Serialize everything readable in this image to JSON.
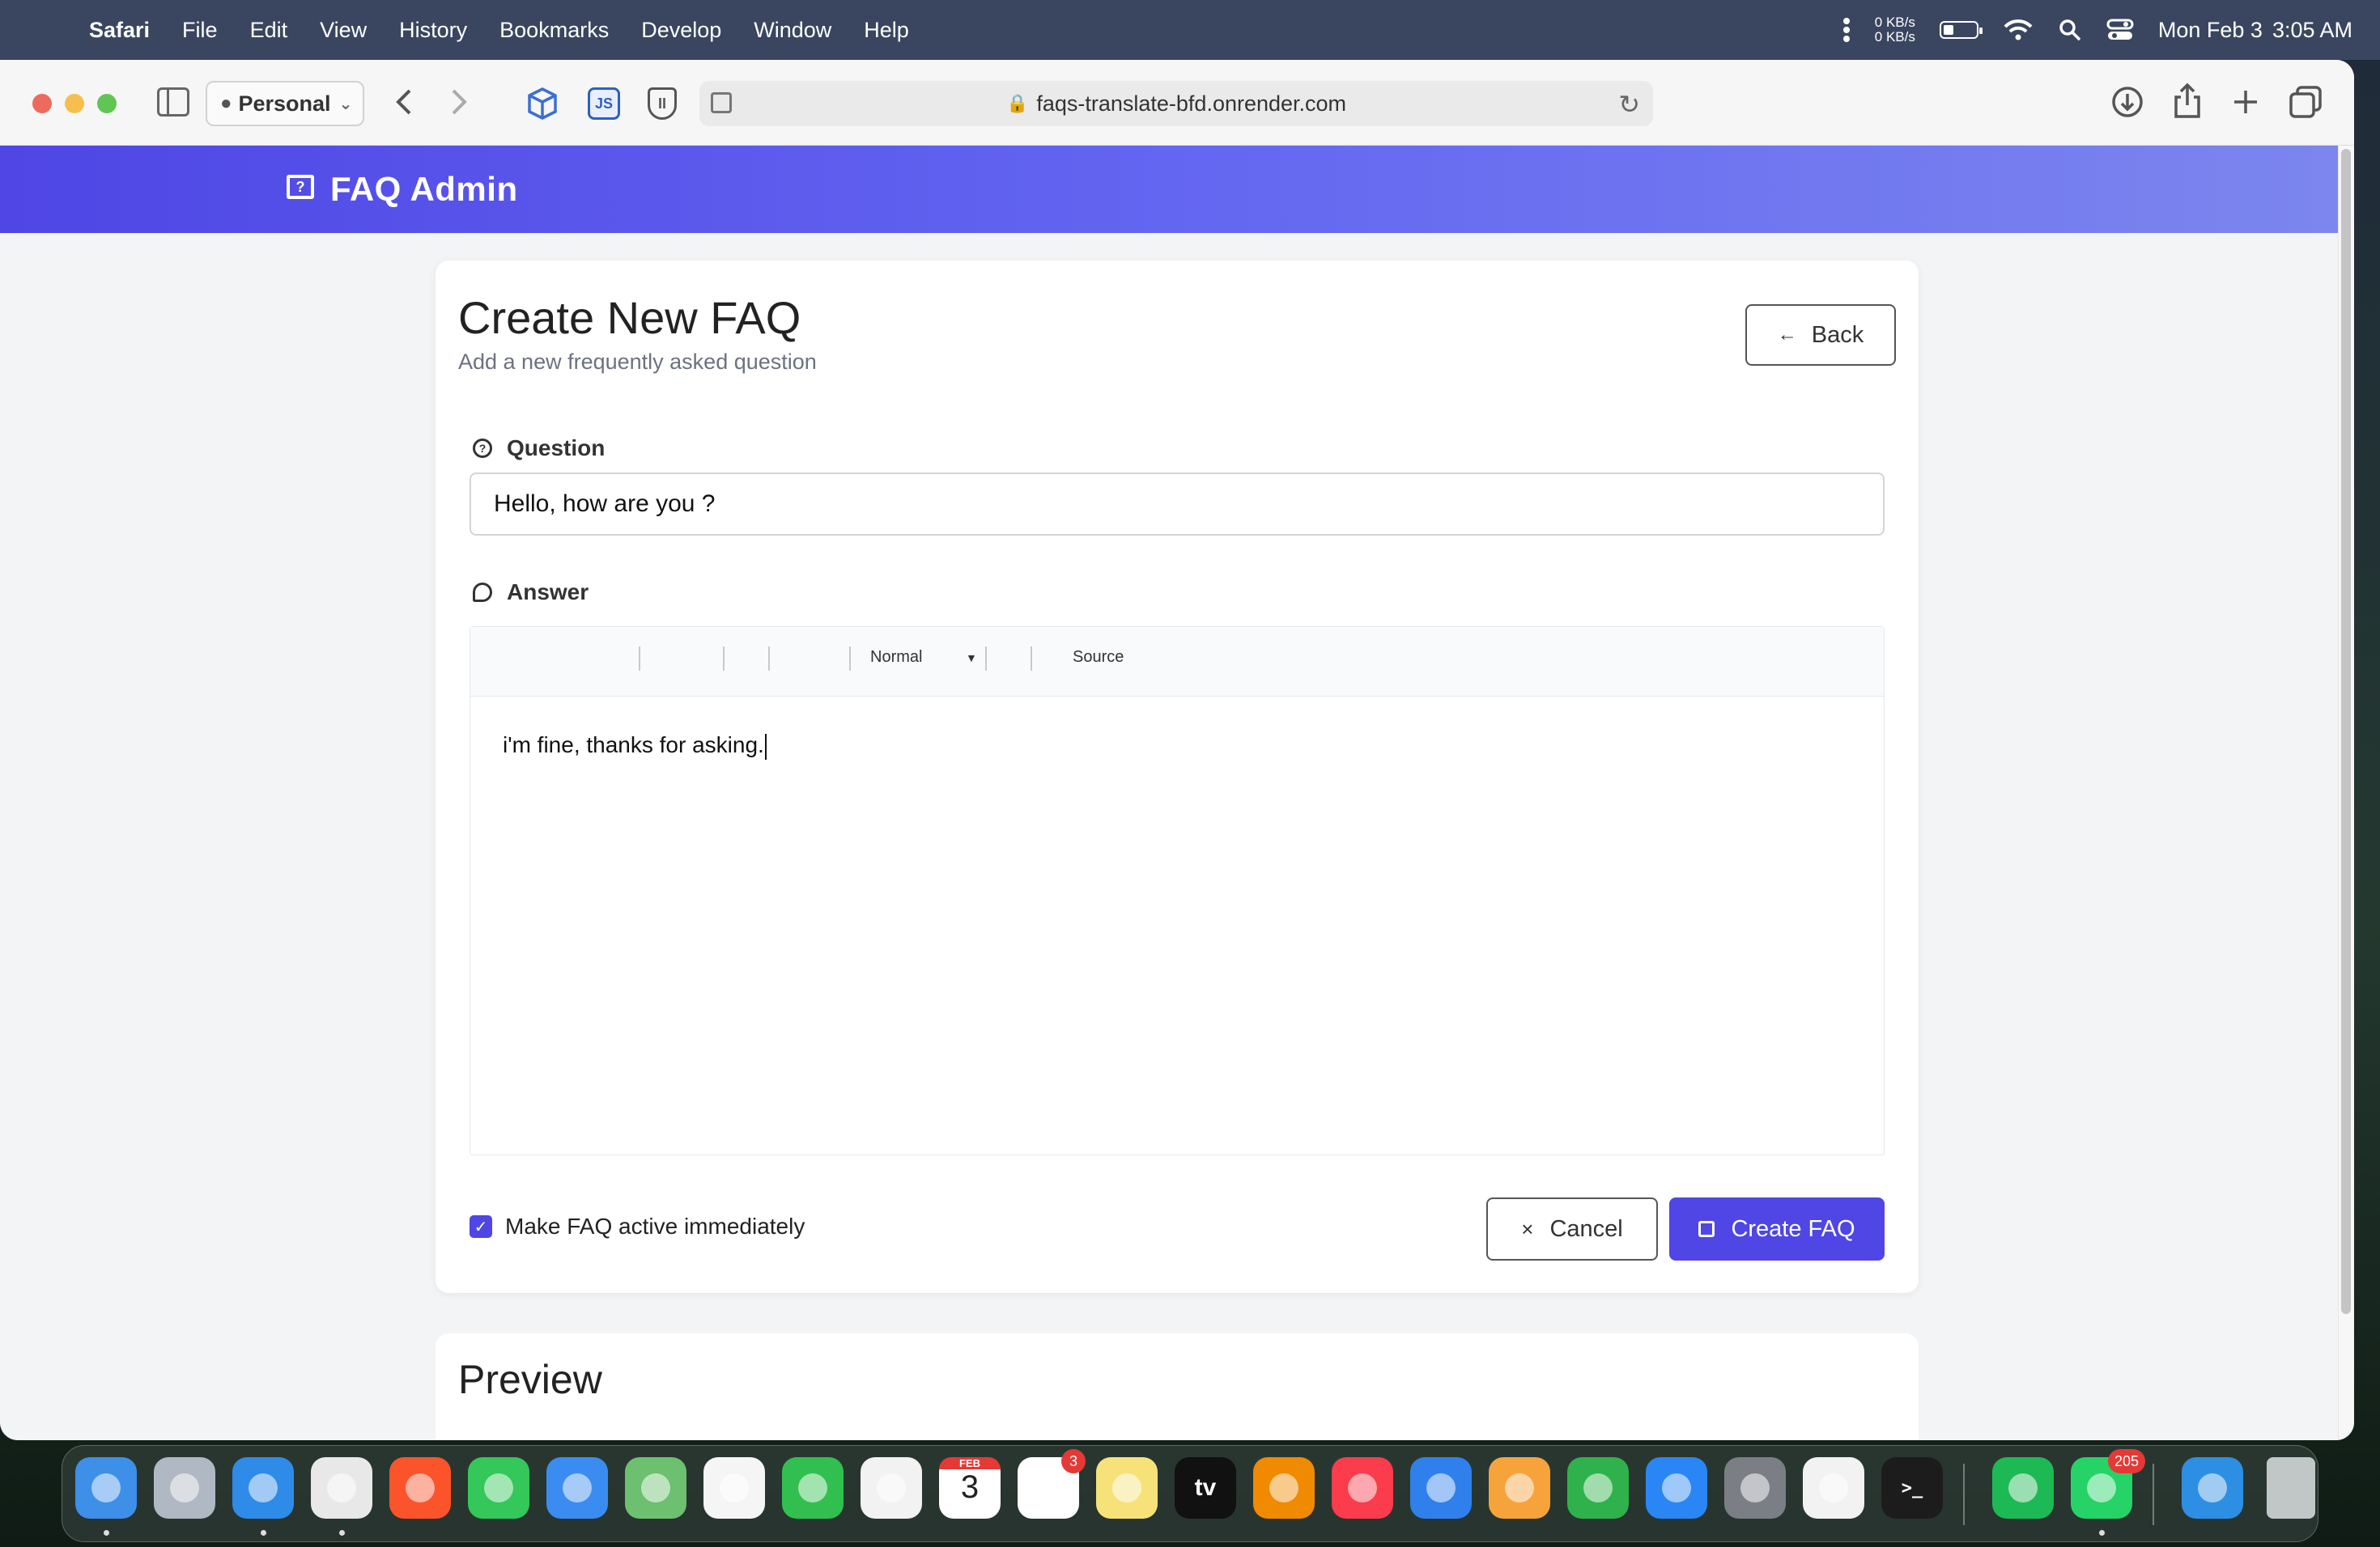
{
  "menubar": {
    "app_name": "Safari",
    "items": [
      "File",
      "Edit",
      "View",
      "History",
      "Bookmarks",
      "Develop",
      "Window",
      "Help"
    ],
    "net_up": "0 KB/s",
    "net_down": "0 KB/s",
    "date": "Mon Feb 3",
    "time": "3:05 AM"
  },
  "browser": {
    "profile": "Personal",
    "url": "faqs-translate-bfd.onrender.com",
    "ext_js_label": "JS",
    "ext_shield_label": "II"
  },
  "navbar": {
    "brand": "FAQ Admin"
  },
  "form": {
    "title": "Create New FAQ",
    "subtitle": "Add a new frequently asked question",
    "back_label": "Back",
    "question_label": "Question",
    "question_value": "Hello, how are you ?",
    "answer_label": "Answer",
    "editor_format": "Normal",
    "editor_source": "Source",
    "answer_value": "i'm fine, thanks for asking.",
    "active_label": "Make FAQ active immediately",
    "active_checked": true,
    "cancel_label": "Cancel",
    "create_label": "Create FAQ"
  },
  "preview": {
    "title": "Preview"
  },
  "dock": {
    "apps": [
      {
        "name": "Finder",
        "icon": "finder-icon",
        "color": "#3d8fe8"
      },
      {
        "name": "Launchpad",
        "icon": "launchpad-icon",
        "color": "#b0b8c4"
      },
      {
        "name": "Safari",
        "icon": "safari-icon",
        "color": "#2f8be8"
      },
      {
        "name": "Chrome",
        "icon": "chrome-icon",
        "color": "#e8e8e8"
      },
      {
        "name": "Brave",
        "icon": "brave-icon",
        "color": "#fb542b"
      },
      {
        "name": "Messages",
        "icon": "messages-icon",
        "color": "#34c759"
      },
      {
        "name": "Mail",
        "icon": "mail-icon",
        "color": "#3a8cf0"
      },
      {
        "name": "Maps",
        "icon": "maps-icon",
        "color": "#6cc070"
      },
      {
        "name": "Photos",
        "icon": "photos-icon",
        "color": "#f5f5f5"
      },
      {
        "name": "FaceTime",
        "icon": "facetime-icon",
        "color": "#31c04f"
      },
      {
        "name": "Spark Mail",
        "icon": "envelope-icon",
        "color": "#f2f2f2"
      },
      {
        "name": "Calendar",
        "icon": "calendar-icon",
        "color": "#ffffff"
      },
      {
        "name": "Reminders",
        "icon": "reminders-icon",
        "color": "#ffffff"
      },
      {
        "name": "Notes",
        "icon": "notes-icon",
        "color": "#f7e27a"
      },
      {
        "name": "Apple TV",
        "icon": "appletv-icon",
        "color": "#111111"
      },
      {
        "name": "VLC",
        "icon": "vlc-icon",
        "color": "#f08a00"
      },
      {
        "name": "Music",
        "icon": "music-icon",
        "color": "#fa3c4c"
      },
      {
        "name": "Keynote",
        "icon": "keynote-icon",
        "color": "#2f80ed"
      },
      {
        "name": "Pages",
        "icon": "pages-icon",
        "color": "#f7a33c"
      },
      {
        "name": "Numbers",
        "icon": "numbers-icon",
        "color": "#2fb24b"
      },
      {
        "name": "App Store",
        "icon": "appstore-icon",
        "color": "#2a86f5"
      },
      {
        "name": "System Settings",
        "icon": "settings-icon",
        "color": "#7b7f85"
      },
      {
        "name": "VS Code",
        "icon": "vscode-icon",
        "color": "#f2f2f2"
      },
      {
        "name": "Terminal",
        "icon": "terminal-icon",
        "color": "#1c1c1c"
      },
      {
        "name": "Spotify",
        "icon": "spotify-icon",
        "color": "#1db954"
      },
      {
        "name": "WhatsApp",
        "icon": "whatsapp-icon",
        "color": "#25d366"
      },
      {
        "name": "Docker",
        "icon": "docker-icon",
        "color": "#2d8fe3"
      },
      {
        "name": "Trash",
        "icon": "trash-icon",
        "color": "#cfd3d6"
      }
    ],
    "calendar_month": "FEB",
    "calendar_day": "3",
    "reminders_badge": "3",
    "whatsapp_badge": "205",
    "appletv_label": "tv",
    "terminal_label": ">_"
  }
}
